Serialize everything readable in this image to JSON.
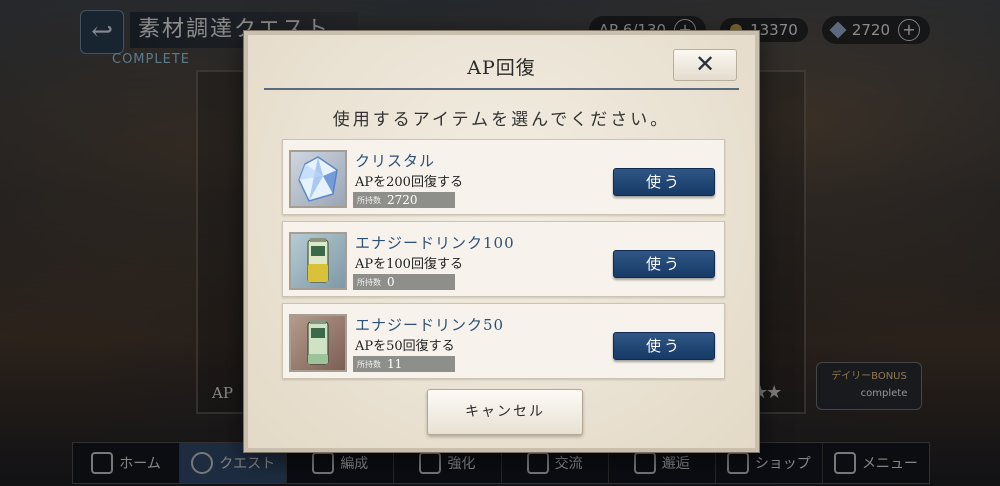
{
  "background": {
    "screen_title": "素材調達クエスト",
    "complete_tag": "COMPLETE",
    "resources": {
      "ap": "AP 6/130",
      "coins": "13370",
      "crystals": "2720"
    },
    "quest_ap_label": "AP",
    "daily_bonus": {
      "label": "デイリーBONUS",
      "status": "complete"
    },
    "nav": [
      {
        "label": "ホーム",
        "icon": "home-icon"
      },
      {
        "label": "クエスト",
        "icon": "quest-icon"
      },
      {
        "label": "編成",
        "icon": "formation-icon"
      },
      {
        "label": "強化",
        "icon": "enhance-icon"
      },
      {
        "label": "交流",
        "icon": "exchange-icon"
      },
      {
        "label": "邂逅",
        "icon": "encounter-icon"
      },
      {
        "label": "ショップ",
        "icon": "shop-icon"
      },
      {
        "label": "メニュー",
        "icon": "menu-icon"
      }
    ]
  },
  "modal": {
    "title": "AP回復",
    "close_label": "✕",
    "prompt": "使用するアイテムを選んでください。",
    "owned_label": "所持数",
    "items": [
      {
        "name": "クリスタル",
        "desc": "APを200回復する",
        "owned": "2720",
        "button": "使う",
        "icon": "crystal-icon"
      },
      {
        "name": "エナジードリンク100",
        "desc": "APを100回復する",
        "owned": "0",
        "button": "使う",
        "icon": "energy-drink-100-icon"
      },
      {
        "name": "エナジードリンク50",
        "desc": "APを50回復する",
        "owned": "11",
        "button": "使う",
        "icon": "energy-drink-50-icon"
      }
    ],
    "cancel_label": "キャンセル"
  },
  "colors": {
    "accent_blue": "#1f4674",
    "panel": "#ebe3d3",
    "item_name": "#2c5078"
  }
}
